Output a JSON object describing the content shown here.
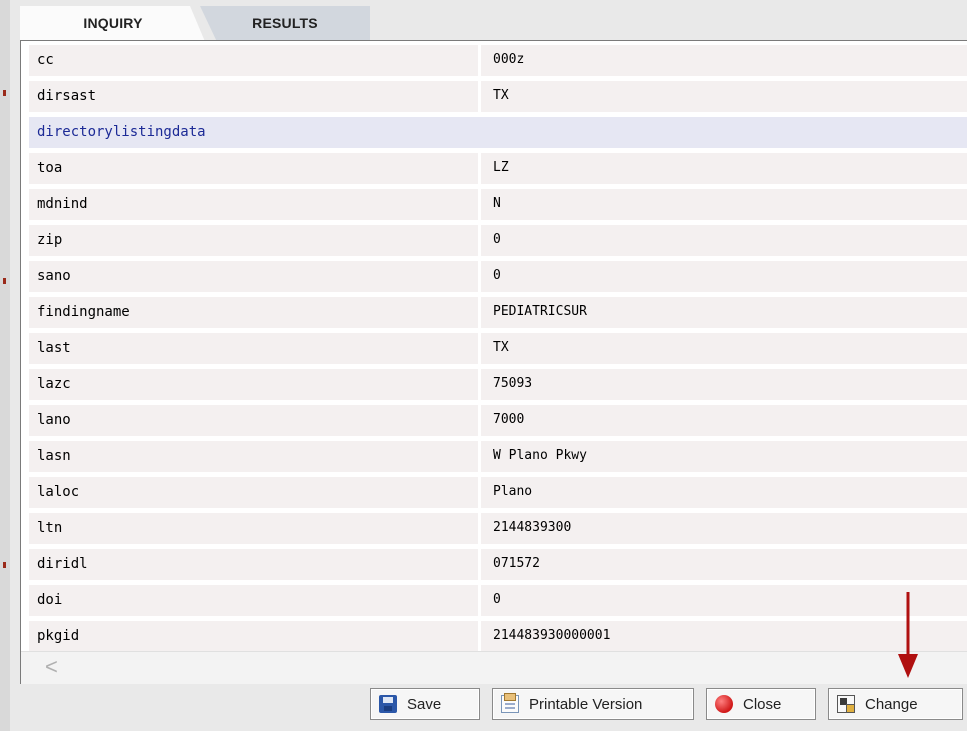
{
  "tabs": [
    {
      "label": "INQUIRY",
      "active": true
    },
    {
      "label": "RESULTS",
      "active": false
    }
  ],
  "rows": [
    {
      "key": "cc",
      "value": "000z"
    },
    {
      "key": "dirsast",
      "value": "TX"
    },
    {
      "section": "directorylistingdata"
    },
    {
      "key": "toa",
      "value": "LZ"
    },
    {
      "key": "mdnind",
      "value": "N"
    },
    {
      "key": "zip",
      "value": "0"
    },
    {
      "key": "sano",
      "value": "0"
    },
    {
      "key": "findingname",
      "value": "PEDIATRICSUR"
    },
    {
      "key": "last",
      "value": "TX"
    },
    {
      "key": "lazc",
      "value": "75093"
    },
    {
      "key": "lano",
      "value": "7000"
    },
    {
      "key": "lasn",
      "value": "W Plano Pkwy"
    },
    {
      "key": "laloc",
      "value": "Plano"
    },
    {
      "key": "ltn",
      "value": "2144839300"
    },
    {
      "key": "diridl",
      "value": "071572"
    },
    {
      "key": "doi",
      "value": "0"
    },
    {
      "key": "pkgid",
      "value": "214483930000001"
    }
  ],
  "buttons": {
    "save": {
      "label": "Save",
      "icon": "save-icon"
    },
    "printable": {
      "label": "Printable Version",
      "icon": "printer-icon"
    },
    "close": {
      "label": "Close",
      "icon": "close-icon"
    },
    "change": {
      "label": "Change",
      "icon": "change-icon"
    }
  },
  "scroll_left_glyph": "<",
  "colors": {
    "section_text": "#1c2a96",
    "arrow": "#b01010"
  }
}
